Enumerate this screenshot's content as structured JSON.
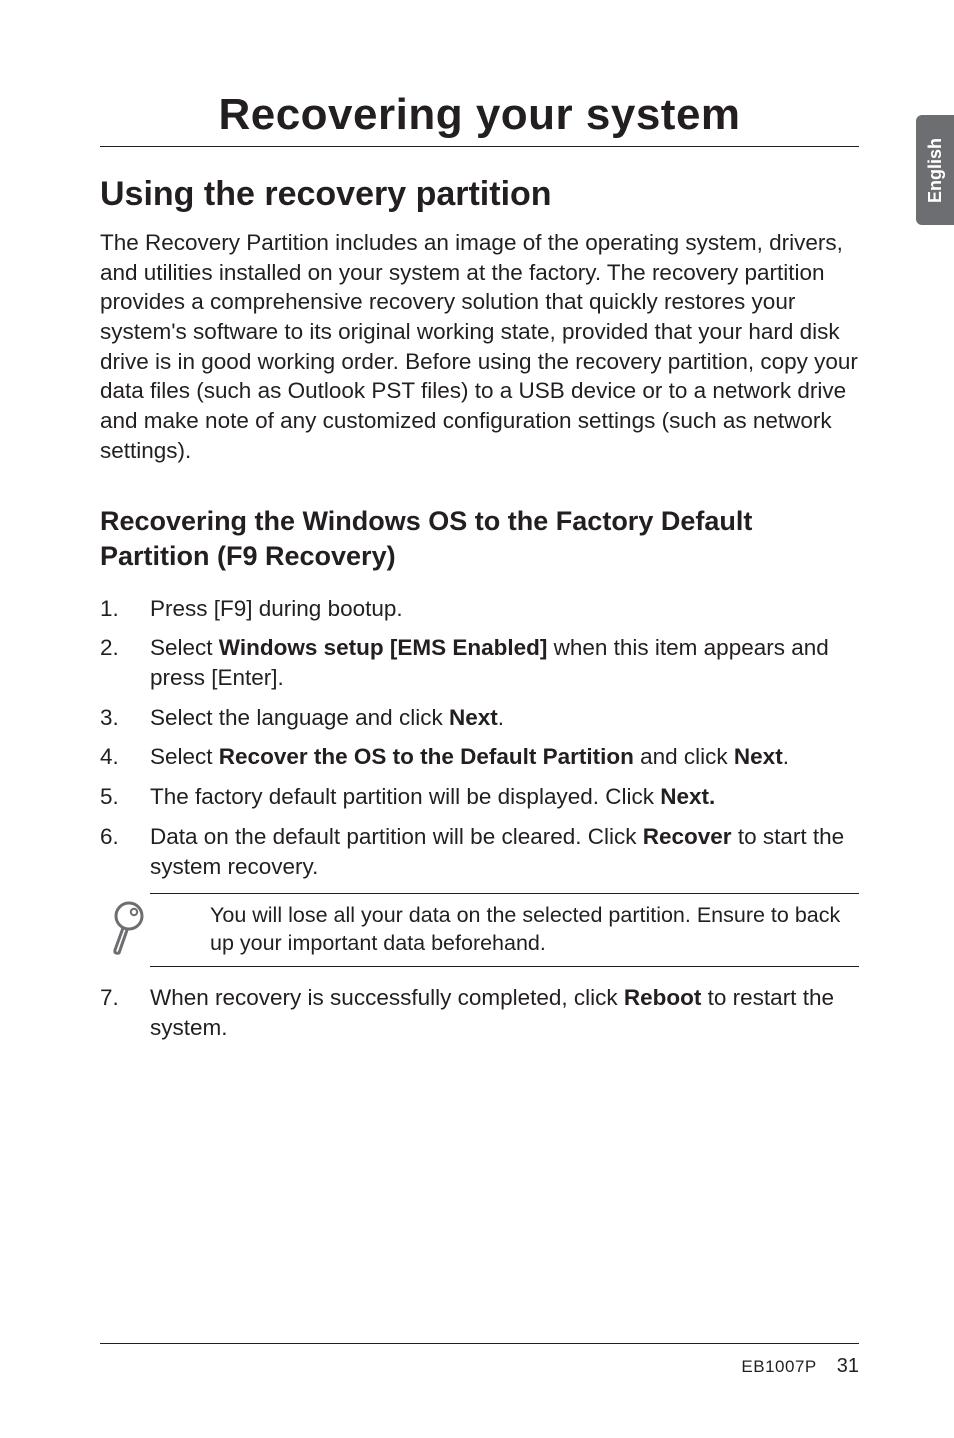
{
  "sideTab": "English",
  "title": "Recovering your system",
  "section": "Using the recovery partition",
  "intro": "The Recovery Partition includes an image of the operating system, drivers, and utilities installed on your system at the factory. The recovery partition provides a comprehensive recovery solution that quickly restores your system's software to its original working state, provided that your hard disk drive is in good working order. Before using the recovery partition, copy your data files (such as Outlook PST files) to a USB device or to a network drive and make note of any customized configuration settings (such as network settings).",
  "subhead": "Recovering the Windows OS to the Factory Default Partition (F9 Recovery)",
  "steps": {
    "s1": "Press [F9] during bootup.",
    "s2a": "Select ",
    "s2b": "Windows setup [EMS Enabled]",
    "s2c": " when this item appears and press [Enter].",
    "s3a": "Select the language and click ",
    "s3b": "Next",
    "s3c": ".",
    "s4a": "Select ",
    "s4b": "Recover the OS to the Default Partition",
    "s4c": " and click ",
    "s4d": "Next",
    "s4e": ".",
    "s5a": "The factory default partition will be displayed. Click ",
    "s5b": "Next.",
    "s6a": "Data on the default partition will be cleared. Click ",
    "s6b": "Recover",
    "s6c": " to start the system recovery.",
    "s7a": "When recovery is successfully completed, click ",
    "s7b": "Reboot",
    "s7c": " to restart the system."
  },
  "note": "You will lose all your data on the selected partition. Ensure to back up your important data beforehand.",
  "footer": {
    "model": "EB1007P",
    "page": "31"
  }
}
